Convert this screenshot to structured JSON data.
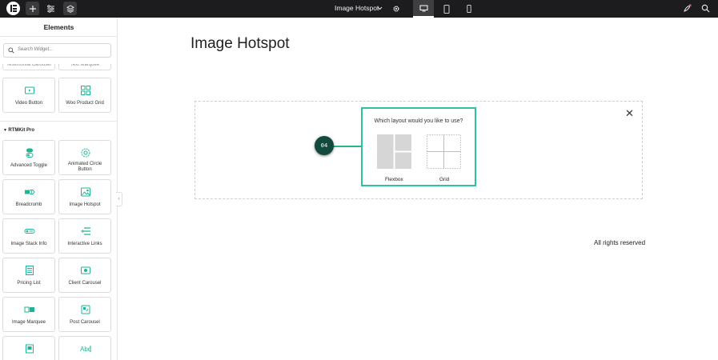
{
  "topbar": {
    "document_title": "Image Hotspot",
    "icons": [
      "elementor-logo-icon",
      "add-icon",
      "sliders-icon",
      "layers-icon",
      "chevron-down-icon",
      "gear-icon",
      "desktop-icon",
      "tablet-icon",
      "mobile-icon",
      "rocket-icon",
      "search-icon"
    ],
    "active_device": "desktop"
  },
  "sidebar": {
    "title": "Elements",
    "search_placeholder": "Search Widget...",
    "top_partial": [
      "Testimonial Carousel",
      "Text Marquee"
    ],
    "row1": [
      "Video Button",
      "Woo Product Grid"
    ],
    "section": "RTMKit Pro",
    "widgets": [
      [
        "Advanced Toggle",
        "Animated Circle Button"
      ],
      [
        "Breadcrumb",
        "Image Hotspot"
      ],
      [
        "Image Stack Info",
        "Interactive Links"
      ],
      [
        "Pricing List",
        "Client Carousel"
      ],
      [
        "Image Marquee",
        "Post Carousel"
      ],
      [
        "",
        ""
      ]
    ],
    "collapse_glyph": "‹",
    "accent_color": "#1fb592"
  },
  "canvas": {
    "page_title": "Image Hotspot",
    "hotspot_label": "04",
    "layout_question": "Which layout would you like to use?",
    "option_flexbox": "Flexbox",
    "option_grid": "Grid",
    "close_glyph": "✕",
    "footer_text": "All rights reserved",
    "highlight_color": "#2dc2a0"
  }
}
